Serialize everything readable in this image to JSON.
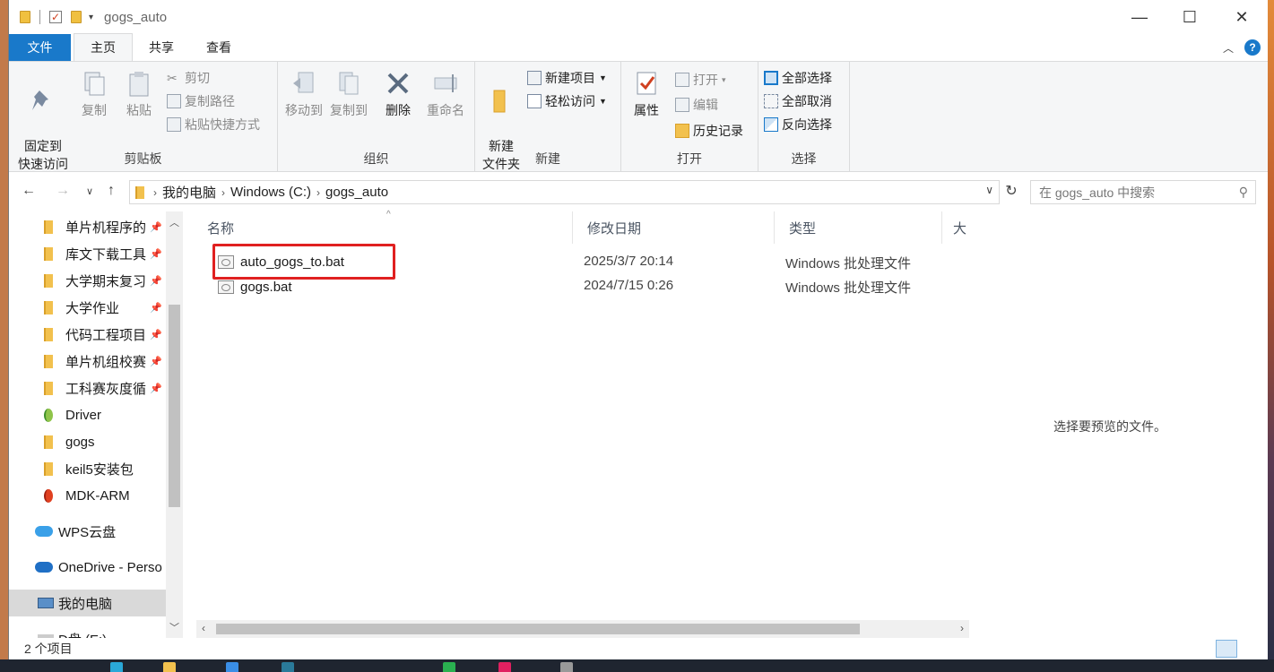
{
  "window": {
    "title": "gogs_auto",
    "controls": {
      "minimize": "—",
      "maximize": "☐",
      "close": "✕"
    }
  },
  "ribbon_tabs": [
    "文件",
    "主页",
    "共享",
    "查看"
  ],
  "ribbon": {
    "clipboard": {
      "label": "剪贴板",
      "pin": "固定到\n快速访问",
      "copy": "复制",
      "paste": "粘贴",
      "cut": "剪切",
      "copy_path": "复制路径",
      "paste_shortcut": "粘贴快捷方式"
    },
    "organize": {
      "label": "组织",
      "move_to": "移动到",
      "copy_to": "复制到",
      "delete": "删除",
      "rename": "重命名"
    },
    "new": {
      "label": "新建",
      "new_folder": "新建\n文件夹",
      "new_item": "新建项目",
      "easy_access": "轻松访问"
    },
    "open": {
      "label": "打开",
      "properties": "属性",
      "open": "打开",
      "edit": "编辑",
      "history": "历史记录"
    },
    "select": {
      "label": "选择",
      "select_all": "全部选择",
      "select_none": "全部取消",
      "invert": "反向选择"
    }
  },
  "address": {
    "crumbs": [
      "我的电脑",
      "Windows (C:)",
      "gogs_auto"
    ],
    "search_placeholder": "在 gogs_auto 中搜索"
  },
  "nav_pane": {
    "items": [
      {
        "label": "单片机程序的",
        "pinned": true,
        "type": "folder"
      },
      {
        "label": "库文下载工具",
        "pinned": true,
        "type": "folder"
      },
      {
        "label": "大学期末复习",
        "pinned": true,
        "type": "folder"
      },
      {
        "label": "大学作业",
        "pinned": true,
        "type": "folder"
      },
      {
        "label": "代码工程项目",
        "pinned": true,
        "type": "folder"
      },
      {
        "label": "单片机组校赛",
        "pinned": true,
        "type": "folder"
      },
      {
        "label": "工科赛灰度循",
        "pinned": true,
        "type": "folder"
      },
      {
        "label": "Driver",
        "pinned": false,
        "type": "special-folder"
      },
      {
        "label": "gogs",
        "pinned": false,
        "type": "folder"
      },
      {
        "label": "keil5安装包",
        "pinned": false,
        "type": "folder"
      },
      {
        "label": "MDK-ARM",
        "pinned": false,
        "type": "special-folder"
      },
      {
        "label": "WPS云盘",
        "pinned": false,
        "type": "cloud"
      },
      {
        "label": "OneDrive - Perso",
        "pinned": false,
        "type": "cloud"
      },
      {
        "label": "我的电脑",
        "pinned": false,
        "type": "computer"
      },
      {
        "label": "D盘 (E:)",
        "pinned": false,
        "type": "drive"
      }
    ]
  },
  "columns": [
    "名称",
    "修改日期",
    "类型",
    "大"
  ],
  "files": [
    {
      "name": "auto_gogs_to.bat",
      "modified": "2025/3/7 20:14",
      "type": "Windows 批处理文件",
      "highlighted": true
    },
    {
      "name": "gogs.bat",
      "modified": "2024/7/15 0:26",
      "type": "Windows 批处理文件",
      "highlighted": false
    }
  ],
  "preview_message": "选择要预览的文件。",
  "status": {
    "item_count": "2 个项目"
  },
  "colors": {
    "accent": "#1979ca",
    "highlight_border": "#e02020",
    "folder": "#f2c14e"
  }
}
